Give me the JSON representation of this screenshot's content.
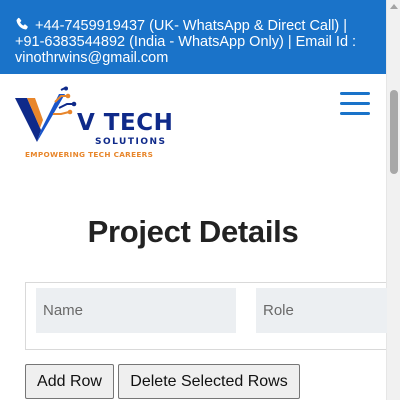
{
  "contact_bar": {
    "text": "+44-7459919437 (UK- WhatsApp & Direct Call) | +91-6383544892 (India - WhatsApp Only) | Email Id : vinothrwins@gmail.com",
    "icon": "phone-icon"
  },
  "logo": {
    "name": "V TECH",
    "sub": "SOLUTIONS",
    "tagline": "EMPOWERING TECH CAREERS",
    "colors": {
      "primary": "#0f2a8a",
      "accent": "#e8862b"
    }
  },
  "menu": {
    "icon": "hamburger-menu-icon"
  },
  "page": {
    "title": "Project Details"
  },
  "form": {
    "name_placeholder": "Name",
    "role_placeholder": "Role"
  },
  "buttons": {
    "add_row": "Add Row",
    "delete_rows": "Delete Selected Rows"
  },
  "colors": {
    "brand_blue": "#1a73c9",
    "field_bg": "#eceff2"
  }
}
